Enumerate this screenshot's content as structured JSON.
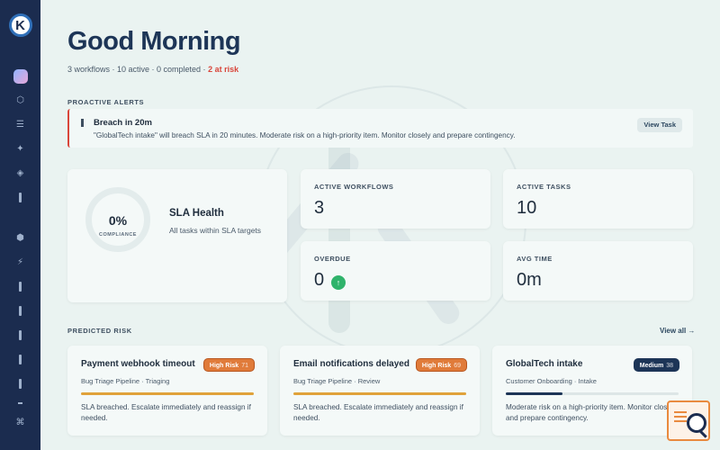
{
  "brand": {
    "logo_letter": "K"
  },
  "sidebar": {
    "items": [
      {
        "name": "home",
        "glyph": ""
      },
      {
        "name": "workflows",
        "glyph": "⬡"
      },
      {
        "name": "list",
        "glyph": "☰"
      },
      {
        "name": "sparkle",
        "glyph": "✦"
      },
      {
        "name": "diamond",
        "glyph": "◈"
      },
      {
        "name": "bars",
        "glyph": ""
      },
      {
        "name": "hexagon",
        "glyph": "⬢"
      },
      {
        "name": "bolt",
        "glyph": "⚡"
      },
      {
        "name": "shortcut",
        "glyph": "⌘"
      }
    ]
  },
  "header": {
    "greeting": "Good Morning",
    "summary": "3 workflows · 10 active · 0 completed · ",
    "risk_count": "2 at risk"
  },
  "alerts": {
    "section_label": "PROACTIVE ALERTS",
    "items": [
      {
        "title": "Breach in 20m",
        "text": "\"GlobalTech intake\" will breach SLA in 20 minutes. Moderate risk on a high-priority item. Monitor closely and prepare contingency.",
        "action": "View Task"
      }
    ]
  },
  "sla": {
    "value": "0%",
    "label": "COMPLIANCE",
    "title": "SLA Health",
    "subtitle": "All tasks within SLA targets"
  },
  "stats": [
    {
      "label": "ACTIVE WORKFLOWS",
      "value": "3"
    },
    {
      "label": "ACTIVE TASKS",
      "value": "10"
    },
    {
      "label": "OVERDUE",
      "value": "0",
      "trend_icon": "↑"
    },
    {
      "label": "AVG TIME",
      "value": "0m"
    }
  ],
  "predicted_risk": {
    "section_label": "PREDICTED RISK",
    "view_all": "View all →",
    "cards": [
      {
        "title": "Payment webhook timeout",
        "badge": "High Risk",
        "score": "71",
        "level": "high",
        "pipeline": "Bug Triage Pipeline · Triaging",
        "progress": 1.0,
        "bar_color": "#e0a23a",
        "text": "SLA breached. Escalate immediately and reassign if needed."
      },
      {
        "title": "Email notifications delayed",
        "badge": "High Risk",
        "score": "69",
        "level": "high",
        "pipeline": "Bug Triage Pipeline · Review",
        "progress": 1.0,
        "bar_color": "#e0a23a",
        "text": "SLA breached. Escalate immediately and reassign if needed."
      },
      {
        "title": "GlobalTech intake",
        "badge": "Medium",
        "score": "38",
        "level": "medium",
        "pipeline": "Customer Onboarding · Intake",
        "progress": 0.33,
        "bar_color": "#1d3557",
        "text": "Moderate risk on a high-priority item. Monitor closely and prepare contingency."
      }
    ]
  }
}
